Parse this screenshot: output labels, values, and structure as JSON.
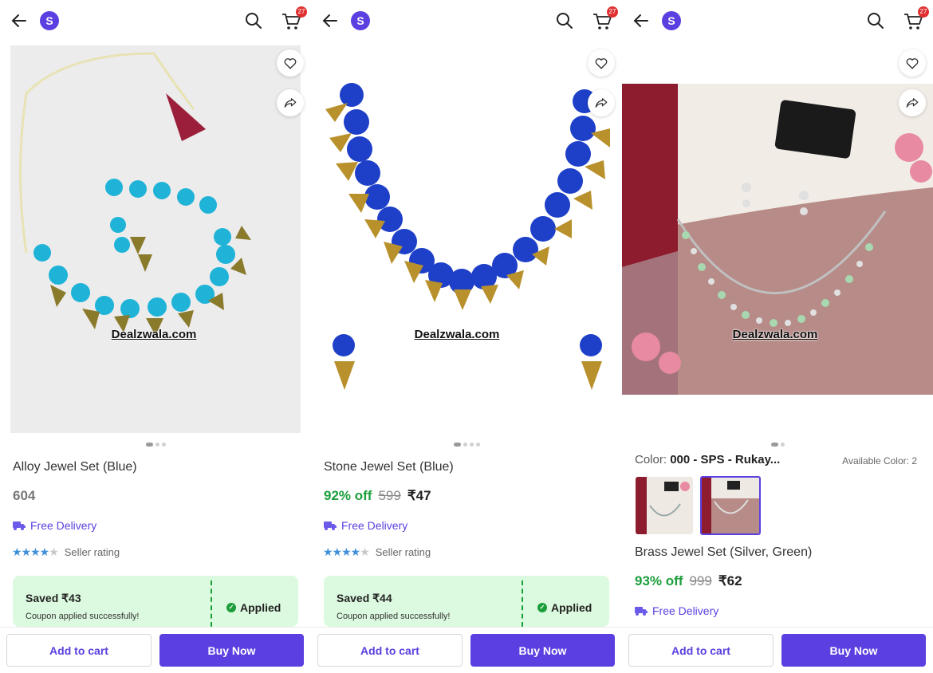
{
  "app": {
    "logo_letter": "S",
    "cart_count": "27"
  },
  "products": [
    {
      "title": "Alloy Jewel Set (Blue)",
      "price_plain": "604",
      "delivery": "Free Delivery",
      "rating_label": "Seller rating",
      "rating_stars": 4,
      "coupon": {
        "saved": "Saved ₹43",
        "message": "Coupon applied successfully!",
        "status": "Applied"
      },
      "watermark": "Dealzwala.com",
      "image_count": 3
    },
    {
      "title": "Stone Jewel Set (Blue)",
      "discount": "92% off",
      "mrp": "599",
      "price": "₹47",
      "delivery": "Free Delivery",
      "rating_label": "Seller rating",
      "rating_stars": 4.5,
      "coupon": {
        "saved": "Saved ₹44",
        "message": "Coupon applied successfully!",
        "status": "Applied"
      },
      "watermark": "Dealzwala.com",
      "image_count": 4
    },
    {
      "title": "Brass Jewel Set (Silver, Green)",
      "color_label": "Color: ",
      "color_value": "000 - SPS - Rukay...",
      "available_colors": "Available Color: 2",
      "discount": "93% off",
      "mrp": "999",
      "price": "₹62",
      "delivery": "Free Delivery",
      "watermark": "Dealzwala.com",
      "image_count": 2
    }
  ],
  "buttons": {
    "add_to_cart": "Add to cart",
    "buy_now": "Buy Now"
  },
  "colors": {
    "accent": "#5b3fe0",
    "discount_green": "#1b9e3a",
    "coupon_bg": "#dcfadf"
  },
  "icons": [
    "back-arrow-icon",
    "search-icon",
    "cart-icon",
    "heart-icon",
    "share-icon",
    "truck-icon",
    "check-icon"
  ]
}
